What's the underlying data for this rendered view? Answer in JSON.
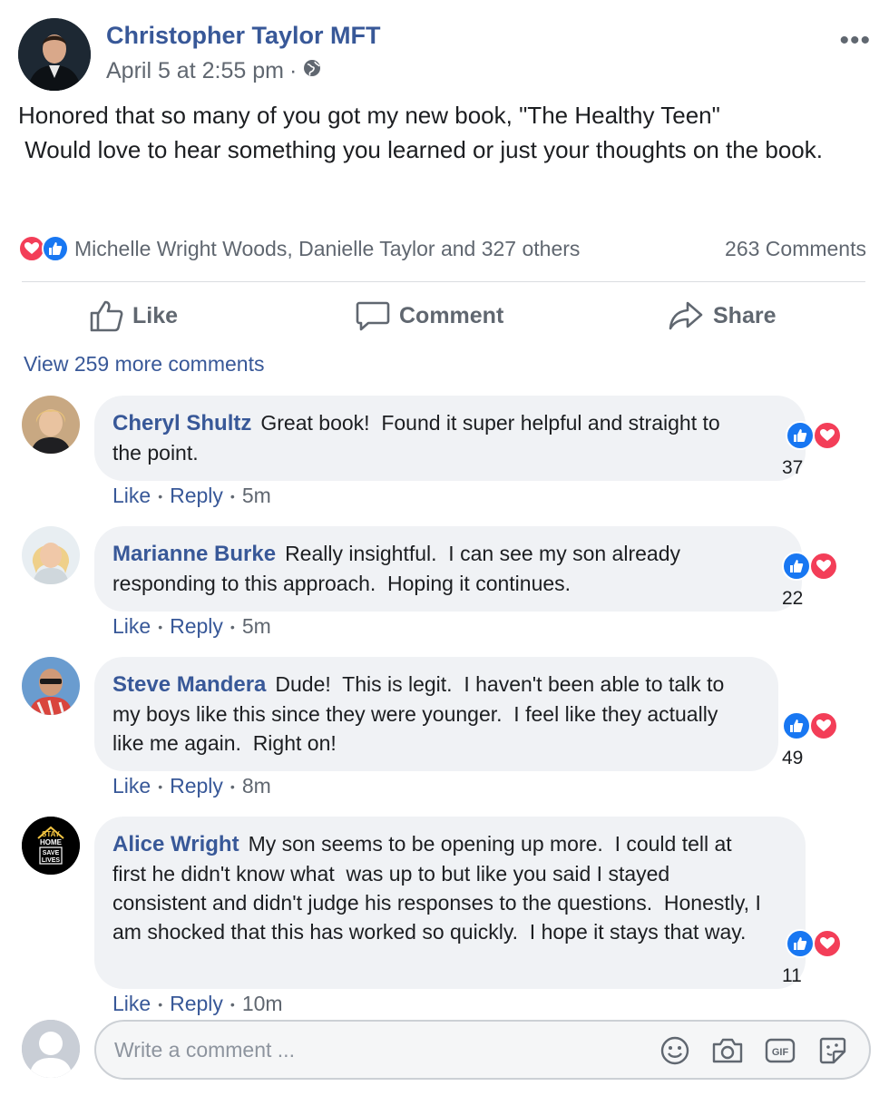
{
  "post": {
    "author": "Christopher Taylor MFT",
    "date": "April 5 at 2:55 pm",
    "meta_separator": "·",
    "privacy_icon": "globe-icon",
    "text": "Honored that so many of you got my new book, \"The Healthy Teen\"\n Would love to hear something you learned or just your thoughts on the book.",
    "reactions": {
      "icons": [
        "heart-icon",
        "like-icon"
      ],
      "names": "Michelle Wright Woods, Danielle Taylor and 327 others",
      "comments_count": "263 Comments"
    },
    "actions": {
      "like": "Like",
      "comment": "Comment",
      "share": "Share"
    },
    "view_more": "View 259 more comments"
  },
  "comments": [
    {
      "name": "Cheryl Shultz",
      "text": "Great book!  Found it super helpful and straight to the point.",
      "reaction_count": "37",
      "like": "Like",
      "reply": "Reply",
      "time": "5m"
    },
    {
      "name": "Marianne Burke",
      "text": "Really insightful.  I can see my son already responding to this approach.  Hoping it continues.",
      "reaction_count": "22",
      "like": "Like",
      "reply": "Reply",
      "time": "5m"
    },
    {
      "name": "Steve Mandera",
      "text": "Dude!  This is legit.  I haven't been able to talk to my boys like this since they were younger.  I feel like they actually like me again.  Right on!",
      "reaction_count": "49",
      "like": "Like",
      "reply": "Reply",
      "time": "8m"
    },
    {
      "name": "Alice Wright",
      "text": "My son seems to be opening up more.  I could tell at first he didn't know what  was up to but like you said I stayed consistent and didn't judge his responses to the questions.  Honestly, I am shocked that this has worked so quickly.  I hope it stays that way.",
      "reaction_count": "11",
      "like": "Like",
      "reply": "Reply",
      "time": "10m",
      "avatar_text": [
        "STAY",
        "HOME",
        "SAVE",
        "LIVES"
      ]
    }
  ],
  "composer": {
    "placeholder": "Write a comment ...",
    "tools": [
      "emoji-icon",
      "camera-icon",
      "gif-icon",
      "sticker-icon"
    ]
  },
  "colors": {
    "link_blue": "#385898",
    "like_blue": "#1877f2",
    "heart_red": "#f33e58",
    "bubble_gray": "#f0f2f5",
    "meta_gray": "#606770"
  }
}
